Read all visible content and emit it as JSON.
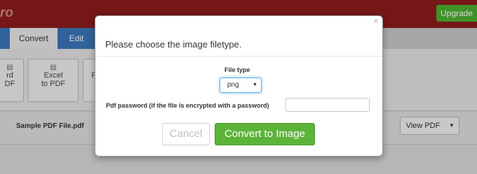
{
  "app": {
    "logo_text": "ro",
    "upgrade_label": "Upgrade"
  },
  "tabs": [
    {
      "label": "Convert"
    },
    {
      "label": "Edit"
    }
  ],
  "toolbar": {
    "items": [
      {
        "icon": "word-file-icon",
        "label_line1": "rd",
        "label_line2": "DF"
      },
      {
        "icon": "excel-file-icon",
        "label_line1": "Excel",
        "label_line2": "to PDF"
      },
      {
        "icon": "powerpoint-file-icon",
        "label_line1": "P",
        "label_line2": ""
      }
    ]
  },
  "file_row": {
    "file_name": "Sample PDF File.pdf",
    "view_label": "View PDF"
  },
  "modal": {
    "close_glyph": "×",
    "title": "Please choose the image filetype.",
    "filetype_label": "File type",
    "filetype_value": "png",
    "password_label": "Pdf password (if the file is encrypted with a password)",
    "password_value": "",
    "cancel_label": "Cancel",
    "convert_label": "Convert to Image"
  },
  "colors": {
    "brand_red": "#8c1c1c",
    "primary_blue": "#3a76b8",
    "success_green": "#5cb33a"
  }
}
